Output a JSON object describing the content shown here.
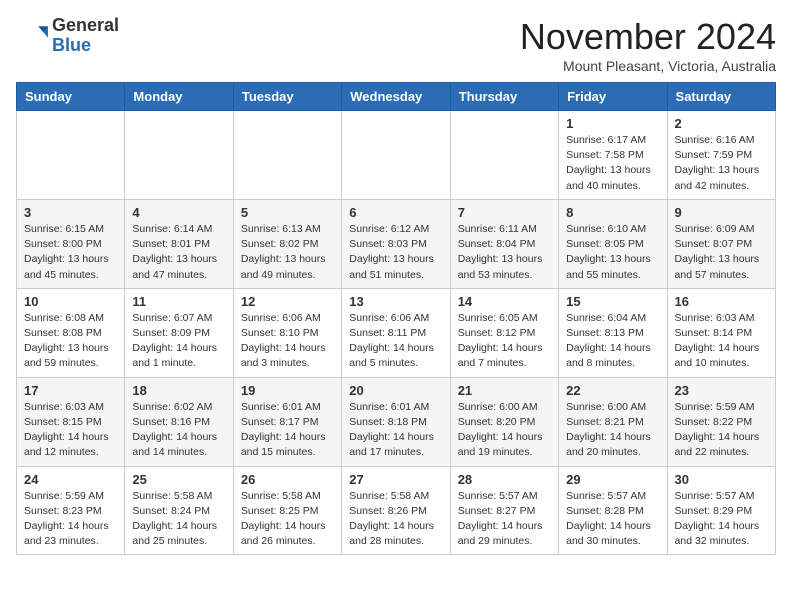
{
  "header": {
    "logo_general": "General",
    "logo_blue": "Blue",
    "month": "November 2024",
    "location": "Mount Pleasant, Victoria, Australia"
  },
  "days_of_week": [
    "Sunday",
    "Monday",
    "Tuesday",
    "Wednesday",
    "Thursday",
    "Friday",
    "Saturday"
  ],
  "weeks": [
    [
      {
        "day": "",
        "info": ""
      },
      {
        "day": "",
        "info": ""
      },
      {
        "day": "",
        "info": ""
      },
      {
        "day": "",
        "info": ""
      },
      {
        "day": "",
        "info": ""
      },
      {
        "day": "1",
        "info": "Sunrise: 6:17 AM\nSunset: 7:58 PM\nDaylight: 13 hours\nand 40 minutes."
      },
      {
        "day": "2",
        "info": "Sunrise: 6:16 AM\nSunset: 7:59 PM\nDaylight: 13 hours\nand 42 minutes."
      }
    ],
    [
      {
        "day": "3",
        "info": "Sunrise: 6:15 AM\nSunset: 8:00 PM\nDaylight: 13 hours\nand 45 minutes."
      },
      {
        "day": "4",
        "info": "Sunrise: 6:14 AM\nSunset: 8:01 PM\nDaylight: 13 hours\nand 47 minutes."
      },
      {
        "day": "5",
        "info": "Sunrise: 6:13 AM\nSunset: 8:02 PM\nDaylight: 13 hours\nand 49 minutes."
      },
      {
        "day": "6",
        "info": "Sunrise: 6:12 AM\nSunset: 8:03 PM\nDaylight: 13 hours\nand 51 minutes."
      },
      {
        "day": "7",
        "info": "Sunrise: 6:11 AM\nSunset: 8:04 PM\nDaylight: 13 hours\nand 53 minutes."
      },
      {
        "day": "8",
        "info": "Sunrise: 6:10 AM\nSunset: 8:05 PM\nDaylight: 13 hours\nand 55 minutes."
      },
      {
        "day": "9",
        "info": "Sunrise: 6:09 AM\nSunset: 8:07 PM\nDaylight: 13 hours\nand 57 minutes."
      }
    ],
    [
      {
        "day": "10",
        "info": "Sunrise: 6:08 AM\nSunset: 8:08 PM\nDaylight: 13 hours\nand 59 minutes."
      },
      {
        "day": "11",
        "info": "Sunrise: 6:07 AM\nSunset: 8:09 PM\nDaylight: 14 hours\nand 1 minute."
      },
      {
        "day": "12",
        "info": "Sunrise: 6:06 AM\nSunset: 8:10 PM\nDaylight: 14 hours\nand 3 minutes."
      },
      {
        "day": "13",
        "info": "Sunrise: 6:06 AM\nSunset: 8:11 PM\nDaylight: 14 hours\nand 5 minutes."
      },
      {
        "day": "14",
        "info": "Sunrise: 6:05 AM\nSunset: 8:12 PM\nDaylight: 14 hours\nand 7 minutes."
      },
      {
        "day": "15",
        "info": "Sunrise: 6:04 AM\nSunset: 8:13 PM\nDaylight: 14 hours\nand 8 minutes."
      },
      {
        "day": "16",
        "info": "Sunrise: 6:03 AM\nSunset: 8:14 PM\nDaylight: 14 hours\nand 10 minutes."
      }
    ],
    [
      {
        "day": "17",
        "info": "Sunrise: 6:03 AM\nSunset: 8:15 PM\nDaylight: 14 hours\nand 12 minutes."
      },
      {
        "day": "18",
        "info": "Sunrise: 6:02 AM\nSunset: 8:16 PM\nDaylight: 14 hours\nand 14 minutes."
      },
      {
        "day": "19",
        "info": "Sunrise: 6:01 AM\nSunset: 8:17 PM\nDaylight: 14 hours\nand 15 minutes."
      },
      {
        "day": "20",
        "info": "Sunrise: 6:01 AM\nSunset: 8:18 PM\nDaylight: 14 hours\nand 17 minutes."
      },
      {
        "day": "21",
        "info": "Sunrise: 6:00 AM\nSunset: 8:20 PM\nDaylight: 14 hours\nand 19 minutes."
      },
      {
        "day": "22",
        "info": "Sunrise: 6:00 AM\nSunset: 8:21 PM\nDaylight: 14 hours\nand 20 minutes."
      },
      {
        "day": "23",
        "info": "Sunrise: 5:59 AM\nSunset: 8:22 PM\nDaylight: 14 hours\nand 22 minutes."
      }
    ],
    [
      {
        "day": "24",
        "info": "Sunrise: 5:59 AM\nSunset: 8:23 PM\nDaylight: 14 hours\nand 23 minutes."
      },
      {
        "day": "25",
        "info": "Sunrise: 5:58 AM\nSunset: 8:24 PM\nDaylight: 14 hours\nand 25 minutes."
      },
      {
        "day": "26",
        "info": "Sunrise: 5:58 AM\nSunset: 8:25 PM\nDaylight: 14 hours\nand 26 minutes."
      },
      {
        "day": "27",
        "info": "Sunrise: 5:58 AM\nSunset: 8:26 PM\nDaylight: 14 hours\nand 28 minutes."
      },
      {
        "day": "28",
        "info": "Sunrise: 5:57 AM\nSunset: 8:27 PM\nDaylight: 14 hours\nand 29 minutes."
      },
      {
        "day": "29",
        "info": "Sunrise: 5:57 AM\nSunset: 8:28 PM\nDaylight: 14 hours\nand 30 minutes."
      },
      {
        "day": "30",
        "info": "Sunrise: 5:57 AM\nSunset: 8:29 PM\nDaylight: 14 hours\nand 32 minutes."
      }
    ]
  ]
}
